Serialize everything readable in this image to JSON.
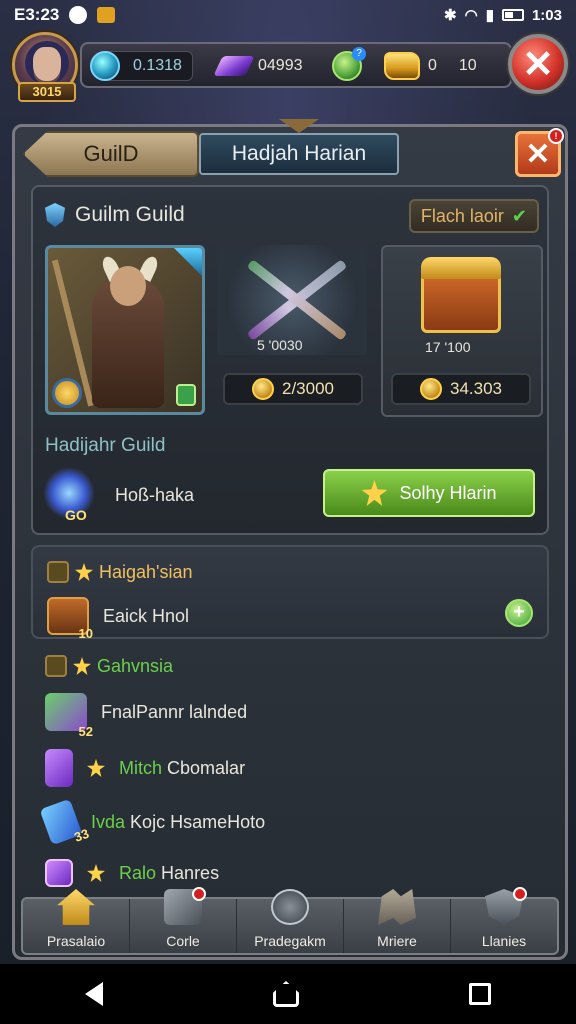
{
  "status_bar": {
    "time": "E3:23",
    "clock_right": "1:03"
  },
  "resources": {
    "level": "3015",
    "blue_currency": "0.1318",
    "purple_gems": "04993",
    "gold_a": "0",
    "gold_b": "10"
  },
  "tabs": {
    "back_label": "GuilD",
    "active_label": "Hadjah Harian",
    "close_badge": "!"
  },
  "guild": {
    "title": "Guilm Guild",
    "flash_badge": "Flach laoir",
    "weapon_label": "5   '0030",
    "weapon_price": "2/3000",
    "chest_label": "17   '100",
    "chest_price": "34.303",
    "subtitle": "Hadijahr Guild",
    "member_name": "Hoß-haka",
    "emblem_value": "GO",
    "join_button": "Solhy Hlarin"
  },
  "sections": [
    {
      "title": "Haigah'sian",
      "items": [
        {
          "label": "Eaick Hnol",
          "qty": "10",
          "icon": "chest-icon"
        }
      ]
    },
    {
      "title": "Gahvnsia",
      "items": [
        {
          "label": "FnalPannr lalnded",
          "qty": "52",
          "icon": "gem-box-icon"
        },
        {
          "label_prefix": "Mitch",
          "label": "Cbomalar",
          "icon": "purple-gem-icon"
        },
        {
          "label_prefix": "Ivda",
          "label": "Kojc HsameHoto",
          "qty": "33",
          "icon": "blue-scroll-icon"
        },
        {
          "label_prefix": "Ralo",
          "label": "Hanres",
          "icon": "cross-box-icon"
        }
      ]
    }
  ],
  "bottom_nav": [
    {
      "label": "Prasalaio",
      "icon": "home-icon",
      "badge": false
    },
    {
      "label": "Corle",
      "icon": "sword-icon",
      "badge": true
    },
    {
      "label": "Pradegakm",
      "icon": "bomb-icon",
      "badge": false
    },
    {
      "label": "Mriere",
      "icon": "map-icon",
      "badge": false
    },
    {
      "label": "Llanies",
      "icon": "shield-icon",
      "badge": true
    }
  ],
  "colors": {
    "accent_gold": "#f0c060",
    "button_green": "#6aaa30",
    "close_red": "#d2332a",
    "tab_blue": "#2f4a5e"
  }
}
